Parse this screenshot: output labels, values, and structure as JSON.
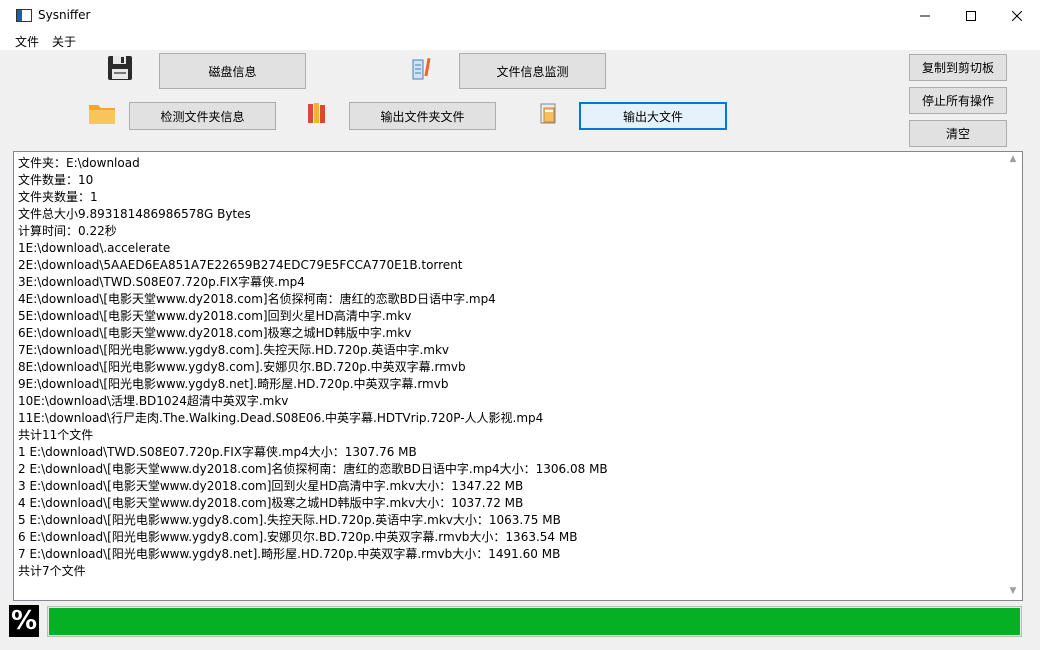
{
  "window": {
    "title": "Sysniffer",
    "minimize_icon": "minimize-icon",
    "maximize_icon": "maximize-icon",
    "close_icon": "close-icon"
  },
  "menu": {
    "file": "文件",
    "about": "关于"
  },
  "toolbar": {
    "disk_info": "磁盘信息",
    "file_monitor": "文件信息监测",
    "detect_folder": "检测文件夹信息",
    "export_folder_files": "输出文件夹文件",
    "export_large_files": "输出大文件",
    "copy_clipboard": "复制到剪切板",
    "stop_all": "停止所有操作",
    "clear": "清空"
  },
  "icons": {
    "floppy": "floppy-disk-icon",
    "file_monitor": "file-monitor-icon",
    "folder": "folder-icon",
    "books": "books-icon",
    "cabinet": "file-cabinet-icon"
  },
  "output_lines": [
    "文件夹：E:\\download",
    "文件数量：10",
    "文件夹数量：1",
    "文件总大小9.893181486986578G Bytes",
    "计算时间：0.22秒",
    "1E:\\download\\.accelerate",
    "2E:\\download\\5AAED6EA851A7E22659B274EDC79E5FCCA770E1B.torrent",
    "3E:\\download\\TWD.S08E07.720p.FIX字幕侠.mp4",
    "4E:\\download\\[电影天堂www.dy2018.com]名侦探柯南：唐红的恋歌BD日语中字.mp4",
    "5E:\\download\\[电影天堂www.dy2018.com]回到火星HD高清中字.mkv",
    "6E:\\download\\[电影天堂www.dy2018.com]极寒之城HD韩版中字.mkv",
    "7E:\\download\\[阳光电影www.ygdy8.com].失控天际.HD.720p.英语中字.mkv",
    "8E:\\download\\[阳光电影www.ygdy8.com].安娜贝尔.BD.720p.中英双字幕.rmvb",
    "9E:\\download\\[阳光电影www.ygdy8.net].畸形屋.HD.720p.中英双字幕.rmvb",
    "10E:\\download\\活埋.BD1024超清中英双字.mkv",
    "11E:\\download\\行尸走肉.The.Walking.Dead.S08E06.中英字幕.HDTVrip.720P-人人影视.mp4",
    "共计11个文件",
    "1 E:\\download\\TWD.S08E07.720p.FIX字幕侠.mp4大小：1307.76 MB",
    "2 E:\\download\\[电影天堂www.dy2018.com]名侦探柯南：唐红的恋歌BD日语中字.mp4大小：1306.08 MB",
    "3 E:\\download\\[电影天堂www.dy2018.com]回到火星HD高清中字.mkv大小：1347.22 MB",
    "4 E:\\download\\[电影天堂www.dy2018.com]极寒之城HD韩版中字.mkv大小：1037.72 MB",
    "5 E:\\download\\[阳光电影www.ygdy8.com].失控天际.HD.720p.英语中字.mkv大小：1063.75 MB",
    "6 E:\\download\\[阳光电影www.ygdy8.com].安娜贝尔.BD.720p.中英双字幕.rmvb大小：1363.54 MB",
    "7 E:\\download\\[阳光电影www.ygdy8.net].畸形屋.HD.720p.中英双字幕.rmvb大小：1491.60 MB",
    "共计7个文件"
  ],
  "progress": {
    "label": "%",
    "value": 1.0,
    "color": "#06b025"
  }
}
